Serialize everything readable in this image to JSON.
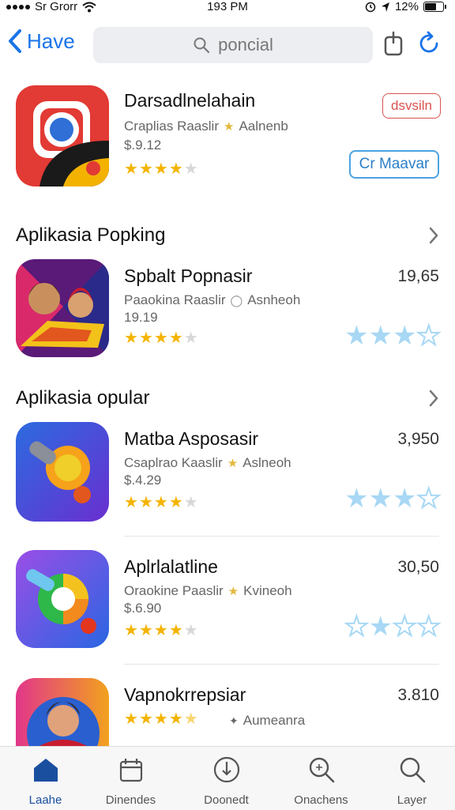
{
  "status_bar": {
    "carrier": "Sr Grorr",
    "time": "193 PM",
    "battery": "12%"
  },
  "nav": {
    "back_label": "Have",
    "search_text": "poncial"
  },
  "featured": {
    "title": "Darsadlnelahain",
    "subtitle": "Craplias Raaslir",
    "author": "Aalnenb",
    "price": "$.9.12",
    "rating": 4,
    "button_red": "dsvsiln",
    "button_blue": "Cr Maavar",
    "colors": {
      "icon_bg": "#e23a34"
    }
  },
  "sections": [
    {
      "title": "Aplikasia Popking",
      "apps": [
        {
          "title": "Spbalt Popnasir",
          "subtitle": "Paaokina Raaslir",
          "author": "Asnheoh",
          "price": "19.19",
          "count": "19,65",
          "rating": 4,
          "right_stars": 3
        }
      ]
    },
    {
      "title": "Aplikasia opular",
      "apps": [
        {
          "title": "Matba Asposasir",
          "subtitle": "Csaplrao Kaaslir",
          "author": "Aslneoh",
          "price": "$.4.29",
          "count": "3,950",
          "rating": 4,
          "right_stars": 3
        },
        {
          "title": "Aplrlalatline",
          "subtitle": "Oraokine Paaslir",
          "author": "Kvineoh",
          "price": "$.6.90",
          "count": "30,50",
          "rating": 4,
          "right_stars": 1.5
        },
        {
          "title": "Vapnokrrepsiar",
          "subtitle": "",
          "author": "Aumeanra",
          "price": "",
          "count": "3.810",
          "rating": 4.5,
          "right_stars": 0
        }
      ]
    }
  ],
  "tabs": [
    {
      "label": "Laahe",
      "icon": "home-icon",
      "active": true
    },
    {
      "label": "Dinendes",
      "icon": "calendar-icon",
      "active": false
    },
    {
      "label": "Doonedt",
      "icon": "download-icon",
      "active": false
    },
    {
      "label": "Onachens",
      "icon": "search-icon",
      "active": false
    },
    {
      "label": "Layer",
      "icon": "search-icon",
      "active": false
    }
  ],
  "colors": {
    "accent": "#1a73e8",
    "star": "#f4b400",
    "star_light": "#a8d8f5",
    "tab_active": "#1a4fa0"
  }
}
